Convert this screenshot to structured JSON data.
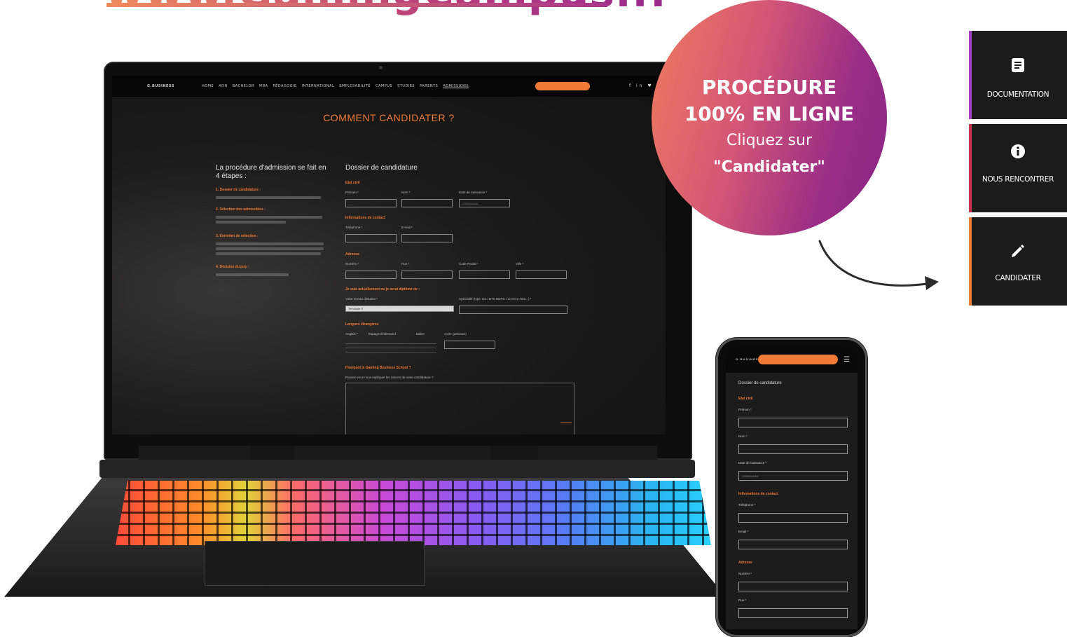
{
  "header": {
    "site_link": "www.GamingCampus.fr"
  },
  "badge": {
    "line1": "PROCÉDURE",
    "line2": "100% EN LIGNE",
    "line3": "Cliquez sur",
    "line4": "\"Candidater\""
  },
  "side_buttons": [
    {
      "label": "DOCUMENTATION",
      "icon": "document-icon",
      "accent": "#a43fc1"
    },
    {
      "label": "NOUS RENCONTRER",
      "icon": "info-icon",
      "accent": "#c7334f"
    },
    {
      "label": "CANDIDATER",
      "icon": "pencil-icon",
      "accent": "#ef7a39"
    }
  ],
  "laptop_screen": {
    "nav_brand": "G.BUSINESS",
    "nav_items": [
      "HOME",
      "ADN",
      "BACHELOR",
      "MBA",
      "PÉDAGOGIE",
      "INTERNATIONAL",
      "EMPLOYABILITÉ",
      "CAMPUS",
      "STUDIES",
      "PARENTS",
      "ADMISSIONS"
    ],
    "nav_social": "f in ♥ ◘",
    "page_heading": "COMMENT CANDIDATER ?",
    "intro_title": "La procédure d'admission se fait en 4 étapes :",
    "steps": [
      "1. Dossier de candidature :",
      "2. Sélection des admissibles :",
      "3. Entretien de sélection :",
      "4. Décision du jury :"
    ],
    "form_title": "Dossier de candidature",
    "sections": [
      "Etat civil",
      "Informations de contact",
      "Adresse",
      "Je suis actuellement ou je serai diplômé de :",
      "Langues étrangères",
      "Pourquoi le Gaming Business School ?"
    ],
    "labels": {
      "prenom": "Prénom *",
      "nom": "Nom *",
      "naissance": "Date de naissance *",
      "telephone": "Téléphone *",
      "email": "E-mail *",
      "numero": "Numéro *",
      "rue": "Rue *",
      "code_postal": "Code Postal *",
      "ville": "Ville *",
      "niveau": "Votre niveau d'études *",
      "specialite": "Spécialité (type: ES / BTS NDRC / Licence AES...) *",
      "anglais": "Anglais *",
      "espagnol": "Espagnol/Allemand",
      "italien": "Italien",
      "autre": "Autre (précisez)",
      "question": "Pouvez-vous nous expliquer les raisons de votre candidature ?"
    },
    "date_placeholder": "JJ/MM/AAAA",
    "select_value": "Terminale S"
  },
  "phone_screen": {
    "brand": "G.BUSINESS",
    "menu": "☰",
    "form_title": "Dossier de candidature",
    "sections": [
      "Etat civil",
      "Informations de contact",
      "Adresse"
    ],
    "labels": [
      "Prénom *",
      "Nom *",
      "Date de naissance *",
      "Téléphone *",
      "Email *",
      "Numéro *",
      "Rue *"
    ],
    "date_placeholder": "JJ/MM/AAAA"
  }
}
